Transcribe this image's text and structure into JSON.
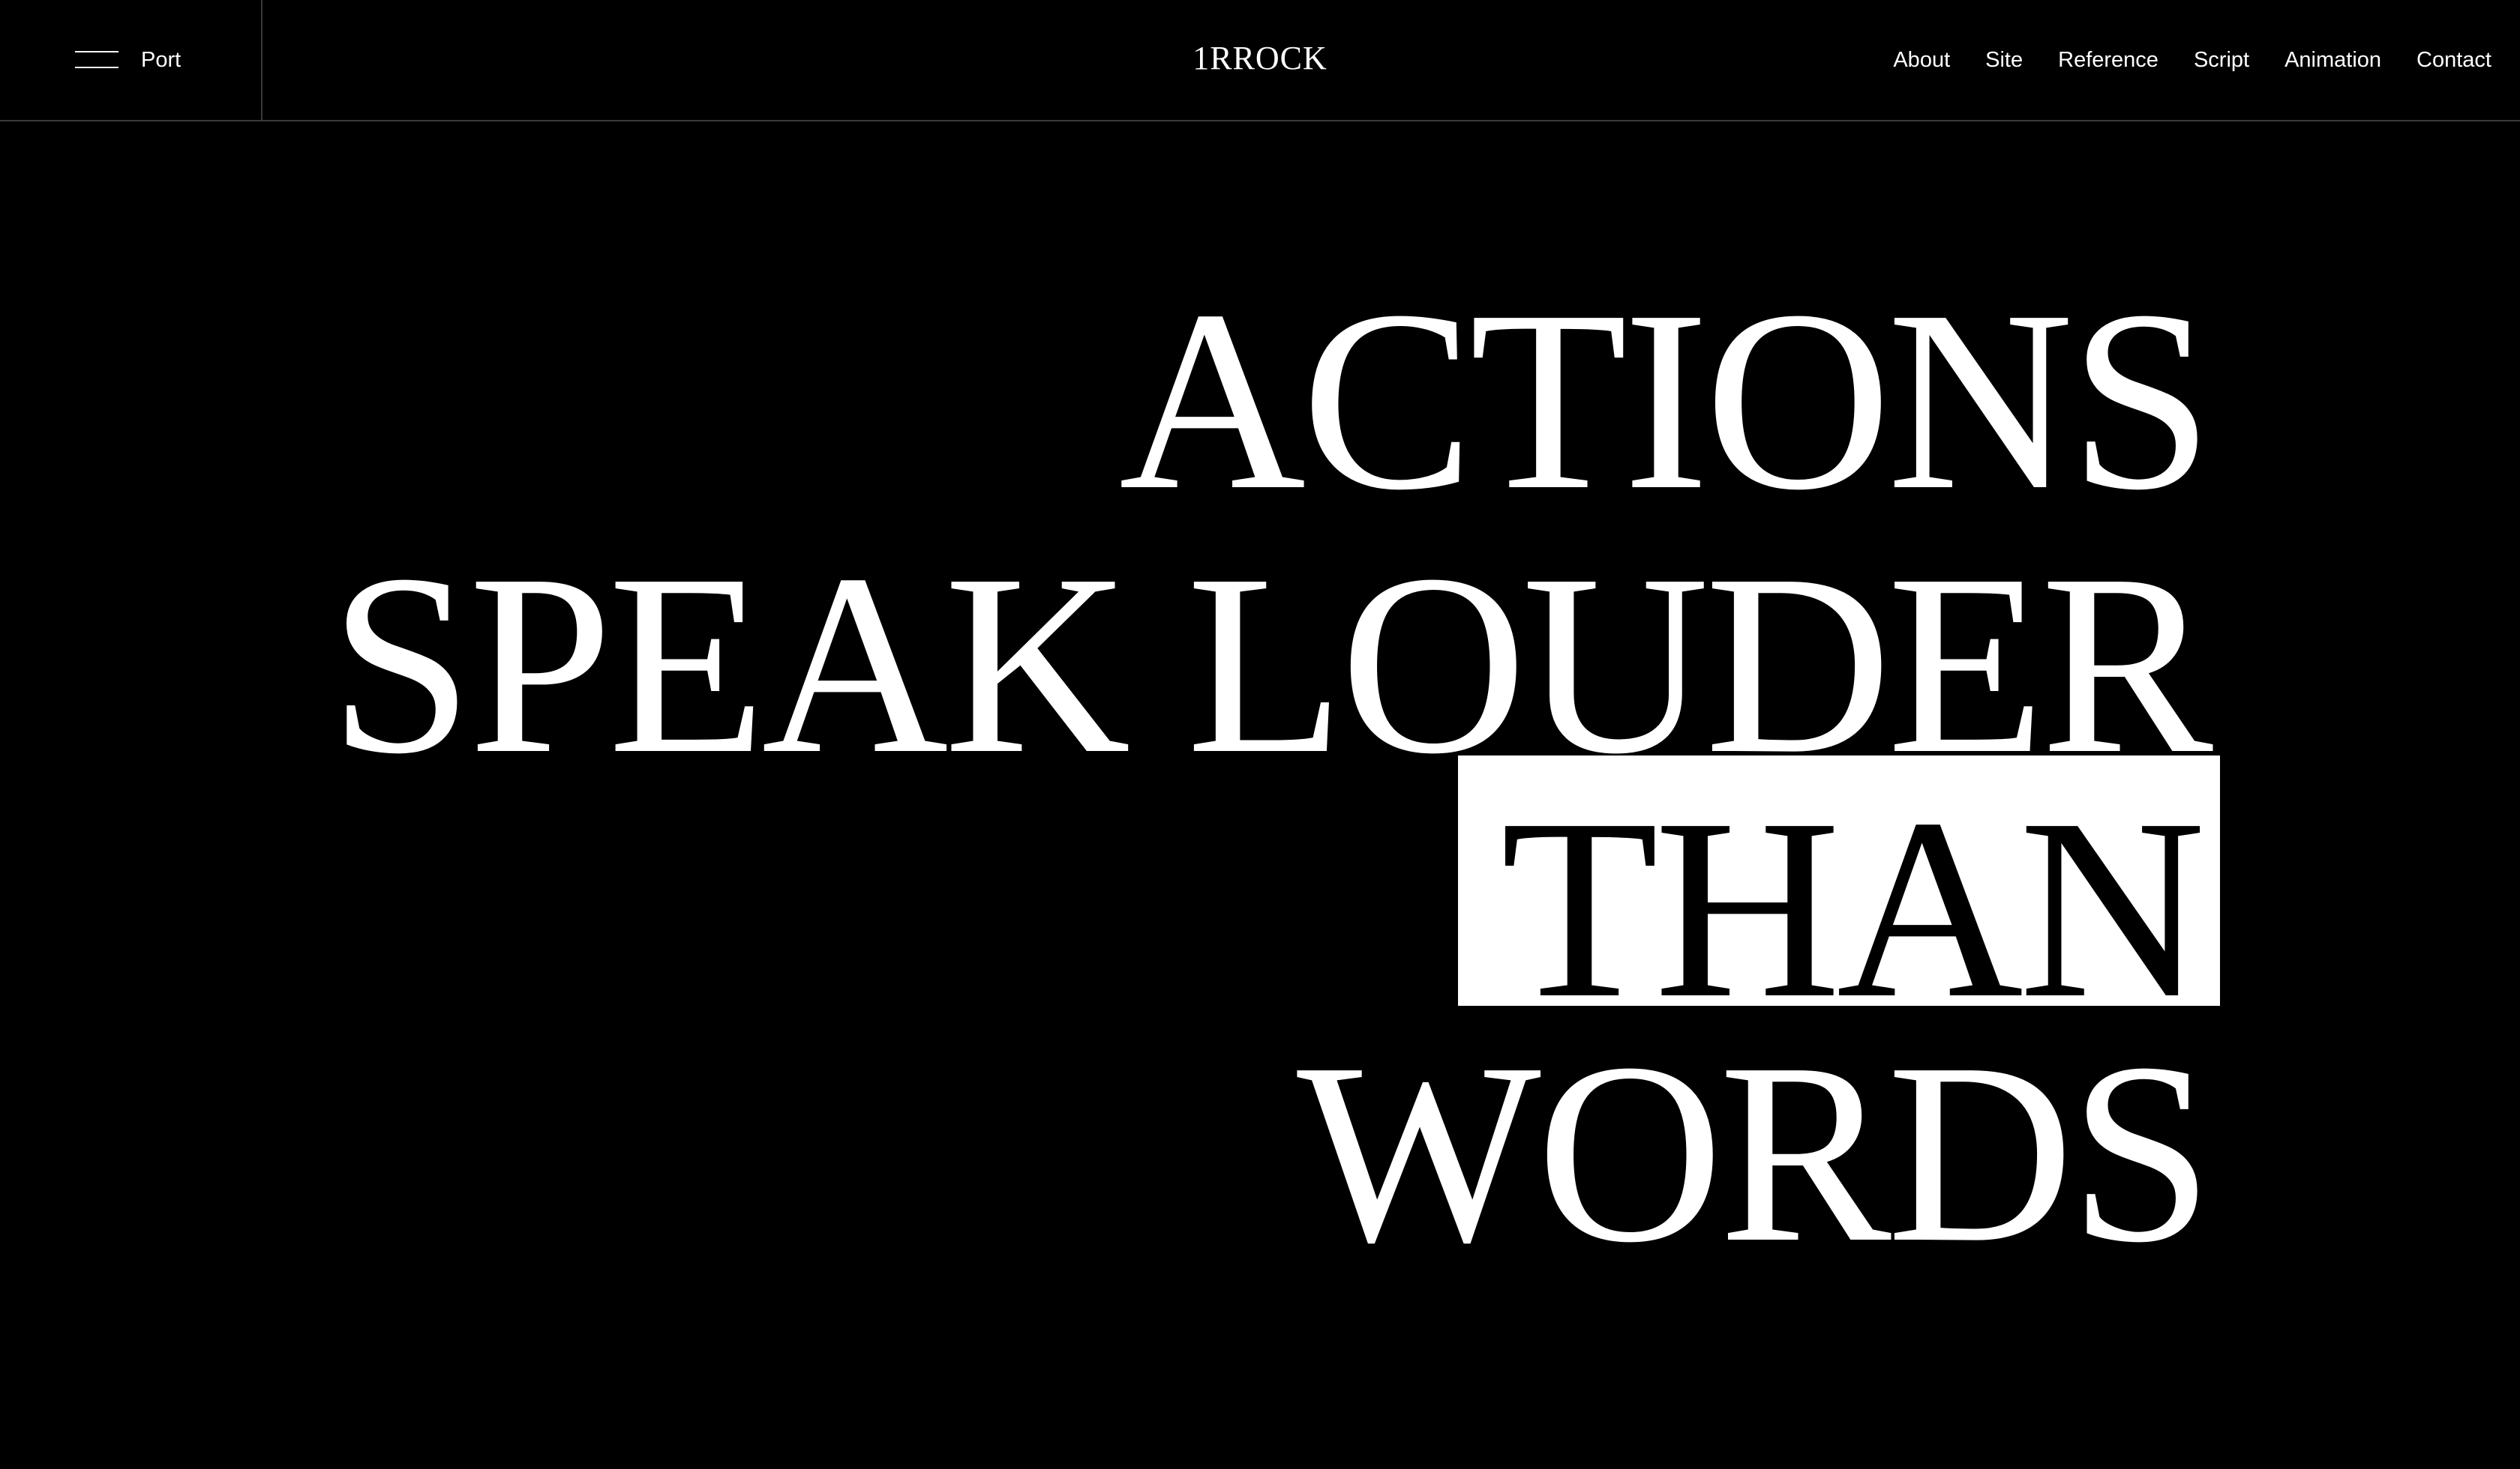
{
  "header": {
    "menu_label": "Port",
    "logo": "1RROCK",
    "nav": [
      "About",
      "Site",
      "Reference",
      "Script",
      "Animation",
      "Contact"
    ]
  },
  "hero": {
    "lines": [
      "ACTIONS",
      "SPEAK LOUDER",
      "THAN",
      "WORDS"
    ],
    "highlighted_line": "THAN"
  },
  "colors": {
    "background": "#000000",
    "foreground": "#ffffff",
    "divider": "#3a3a3a"
  },
  "icons": {
    "menu": "hamburger-icon"
  }
}
